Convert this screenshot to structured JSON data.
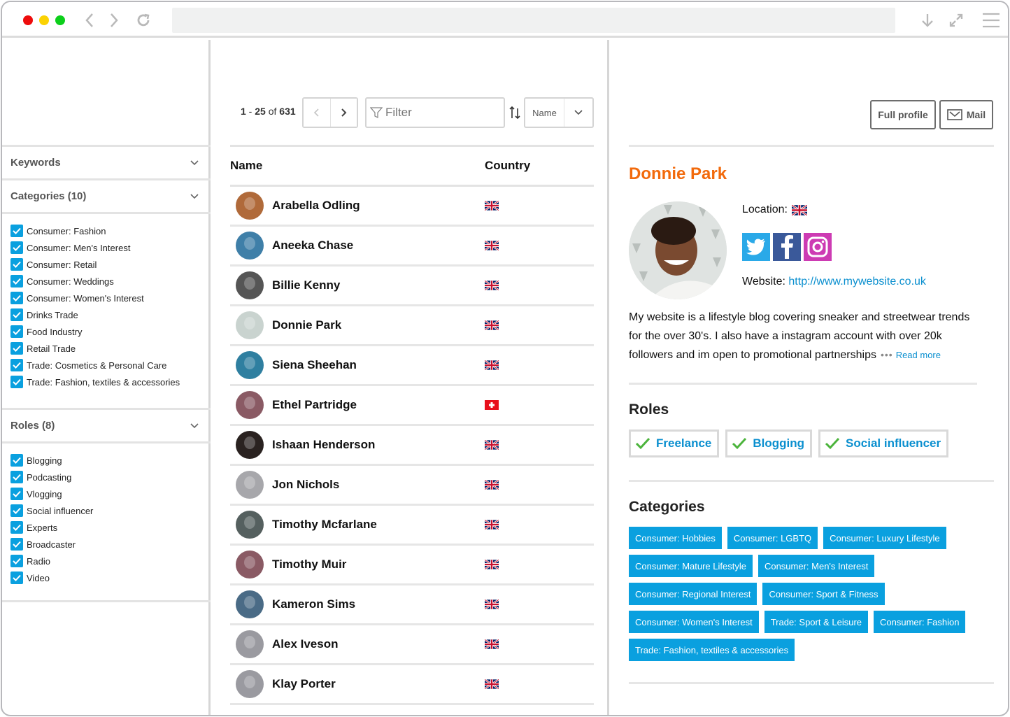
{
  "browser": {
    "traffic_lights": [
      "close",
      "minimize",
      "maximize"
    ],
    "nav_icons": [
      "back-icon",
      "forward-icon",
      "reload-icon"
    ],
    "right_icons": [
      "download-icon",
      "expand-icon",
      "menu-icon"
    ],
    "url": ""
  },
  "sidebar": {
    "keywords": {
      "title": "Keywords"
    },
    "categories": {
      "title": "Categories (10)",
      "items": [
        {
          "label": "Consumer: Fashion",
          "checked": true
        },
        {
          "label": "Consumer: Men's Interest",
          "checked": true
        },
        {
          "label": "Consumer: Retail",
          "checked": true
        },
        {
          "label": "Consumer: Weddings",
          "checked": true
        },
        {
          "label": "Consumer: Women's Interest",
          "checked": true
        },
        {
          "label": "Drinks Trade",
          "checked": true
        },
        {
          "label": "Food Industry",
          "checked": true
        },
        {
          "label": "Retail Trade",
          "checked": true
        },
        {
          "label": "Trade: Cosmetics & Personal Care",
          "checked": true
        },
        {
          "label": "Trade: Fashion, textiles & accessories",
          "checked": true
        }
      ]
    },
    "roles": {
      "title": "Roles (8)",
      "items": [
        {
          "label": "Blogging",
          "checked": true
        },
        {
          "label": "Podcasting",
          "checked": true
        },
        {
          "label": "Vlogging",
          "checked": true
        },
        {
          "label": "Social influencer",
          "checked": true
        },
        {
          "label": "Experts",
          "checked": true
        },
        {
          "label": "Broadcaster",
          "checked": true
        },
        {
          "label": "Radio",
          "checked": true
        },
        {
          "label": "Video",
          "checked": true
        }
      ]
    }
  },
  "list": {
    "range_start": "1",
    "range_end": "25",
    "range_of": "of",
    "total": "631",
    "filter_placeholder": "Filter",
    "sort_value": "Name",
    "columns": {
      "name": "Name",
      "country": "Country"
    },
    "rows": [
      {
        "name": "Arabella Odling",
        "country": "UK"
      },
      {
        "name": "Aneeka Chase",
        "country": "UK"
      },
      {
        "name": "Billie Kenny",
        "country": "UK"
      },
      {
        "name": "Donnie Park",
        "country": "UK"
      },
      {
        "name": "Siena Sheehan",
        "country": "UK"
      },
      {
        "name": "Ethel Partridge",
        "country": "CH"
      },
      {
        "name": "Ishaan Henderson",
        "country": "UK"
      },
      {
        "name": "Jon Nichols",
        "country": "UK"
      },
      {
        "name": "Timothy Mcfarlane",
        "country": "UK"
      },
      {
        "name": "Timothy Muir",
        "country": "UK"
      },
      {
        "name": "Kameron Sims",
        "country": "UK"
      },
      {
        "name": "Alex Iveson",
        "country": "UK"
      },
      {
        "name": "Klay Porter",
        "country": "UK"
      }
    ]
  },
  "detail": {
    "full_profile_label": "Full profile",
    "mail_label": "Mail",
    "name": "Donnie Park",
    "location_label": "Location:",
    "location_country": "UK",
    "socials": [
      "twitter",
      "facebook",
      "instagram"
    ],
    "website_label": "Website:",
    "website_url": "http://www.mywebsite.co.uk",
    "bio": "My website is a lifestyle blog covering sneaker and streetwear trends for the over 30's. I also have a instagram account with over 20k followers and im open to promotional partnerships",
    "bio_ellipsis": "•••",
    "read_more": "Read more",
    "roles_title": "Roles",
    "roles": [
      "Freelance",
      "Blogging",
      "Social influencer"
    ],
    "categories_title": "Categories",
    "categories": [
      "Consumer: Hobbies",
      "Consumer: LGBTQ",
      "Consumer: Luxury Lifestyle",
      "Consumer: Mature Lifestyle",
      "Consumer: Men's Interest",
      "Consumer: Regional Interest",
      "Consumer: Sport & Fitness",
      "Consumer: Women's Interest",
      "Trade: Sport & Leisure",
      "Consumer: Fashion",
      "Trade: Fashion, textiles & accessories"
    ]
  },
  "colors": {
    "accent_blue": "#0aa0df",
    "link_blue": "#0a8fcf",
    "name_orange": "#f26a0c",
    "check_green": "#4cb43c"
  }
}
